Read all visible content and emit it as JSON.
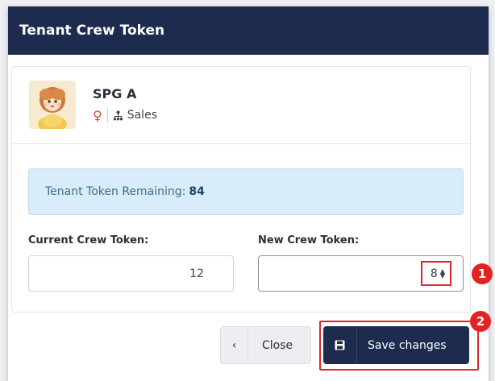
{
  "modal": {
    "title": "Tenant Crew Token"
  },
  "crew": {
    "name": "SPG A",
    "department": "Sales",
    "gender_icon": "female-icon",
    "department_icon": "org-chart-icon"
  },
  "alert": {
    "label": "Tenant Token Remaining:",
    "value": "84"
  },
  "fields": {
    "current_label": "Current Crew Token:",
    "current_value": "12",
    "new_label": "New Crew Token:",
    "new_value": "8"
  },
  "buttons": {
    "close_label": "Close",
    "save_label": "Save changes"
  },
  "annotations": {
    "badge_1": "1",
    "badge_2": "2"
  },
  "colors": {
    "header": "#1d2b4f",
    "primary_button": "#1d2b4f",
    "alert_bg": "#d9ecf9",
    "highlight": "#e0262a",
    "female_icon": "#e0463e"
  }
}
